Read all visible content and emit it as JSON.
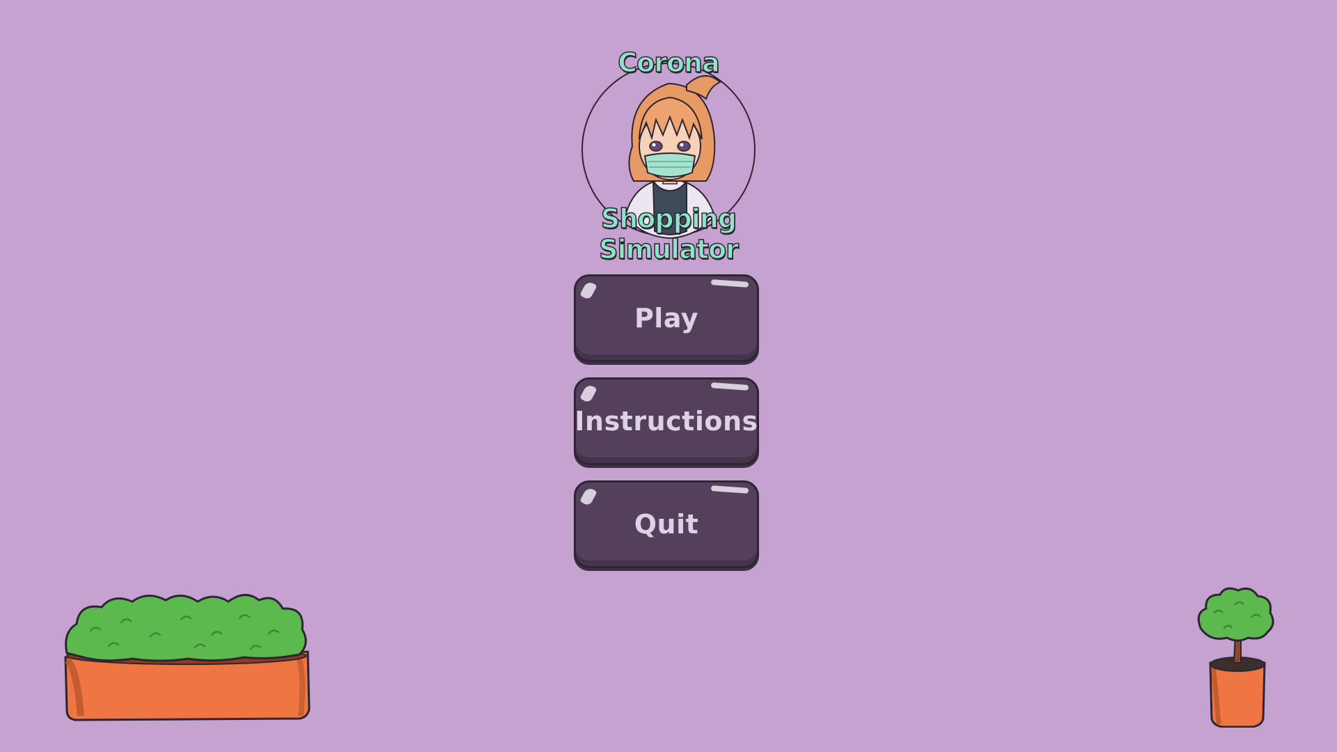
{
  "game": {
    "title_top": "Corona",
    "title_bottom": "Shopping Simulator"
  },
  "menu": {
    "play_label": "Play",
    "instructions_label": "Instructions",
    "quit_label": "Quit"
  },
  "colors": {
    "background": "#c5a2cf",
    "button": "#54405c",
    "button_text": "#ddd2e4",
    "title_text": "#8fe3c8",
    "planter": "#ef7542",
    "foliage": "#5cb94d"
  },
  "decor": {
    "character": "character-portrait-icon",
    "left_planter": "bush-planter-icon",
    "right_planter": "potted-tree-icon"
  }
}
